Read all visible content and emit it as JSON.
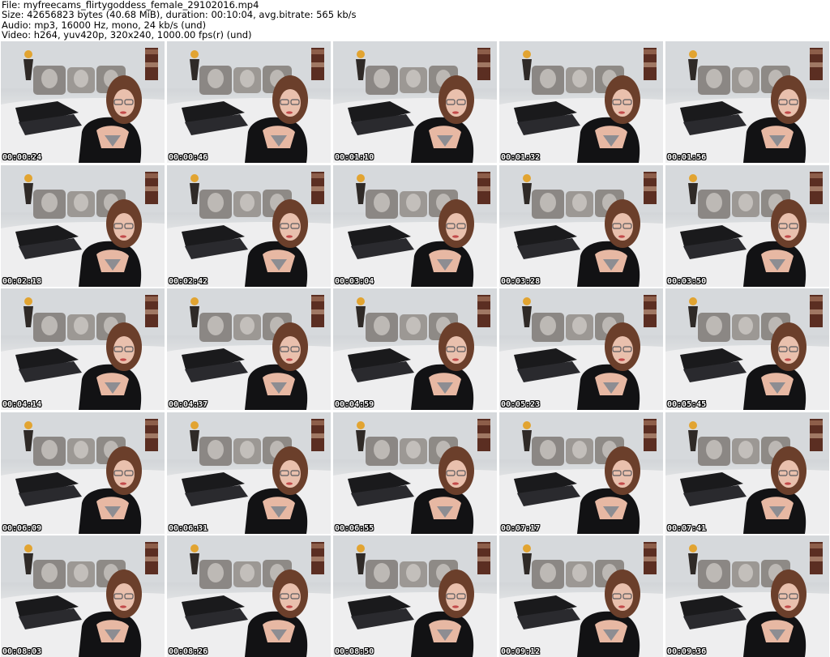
{
  "header": {
    "line1": "File: myfreecams_flirtygoddess_female_29102016.mp4",
    "line2": "Size: 42656823 bytes (40.68 MiB), duration: 00:10:04, avg.bitrate: 565 kb/s",
    "line3": "Audio: mp3, 16000 Hz, mono, 24 kb/s (und)",
    "line4": "Video: h264, yuv420p, 320x240, 1000.00 fps(r) (und)"
  },
  "thumbnails": [
    {
      "timestamp": "00:00:24"
    },
    {
      "timestamp": "00:00:46"
    },
    {
      "timestamp": "00:01:10"
    },
    {
      "timestamp": "00:01:32"
    },
    {
      "timestamp": "00:01:56"
    },
    {
      "timestamp": "00:02:18"
    },
    {
      "timestamp": "00:02:42"
    },
    {
      "timestamp": "00:03:04"
    },
    {
      "timestamp": "00:03:28"
    },
    {
      "timestamp": "00:03:50"
    },
    {
      "timestamp": "00:04:14"
    },
    {
      "timestamp": "00:04:37"
    },
    {
      "timestamp": "00:04:59"
    },
    {
      "timestamp": "00:05:23"
    },
    {
      "timestamp": "00:05:45"
    },
    {
      "timestamp": "00:06:09"
    },
    {
      "timestamp": "00:06:31"
    },
    {
      "timestamp": "00:06:55"
    },
    {
      "timestamp": "00:07:17"
    },
    {
      "timestamp": "00:07:41"
    },
    {
      "timestamp": "00:08:03"
    },
    {
      "timestamp": "00:08:26"
    },
    {
      "timestamp": "00:08:50"
    },
    {
      "timestamp": "00:09:12"
    },
    {
      "timestamp": "00:09:36"
    }
  ],
  "colors": {
    "background": "#ffffff",
    "text": "#000000",
    "timestamp_text": "#ffffff",
    "timestamp_outline": "#000000"
  }
}
